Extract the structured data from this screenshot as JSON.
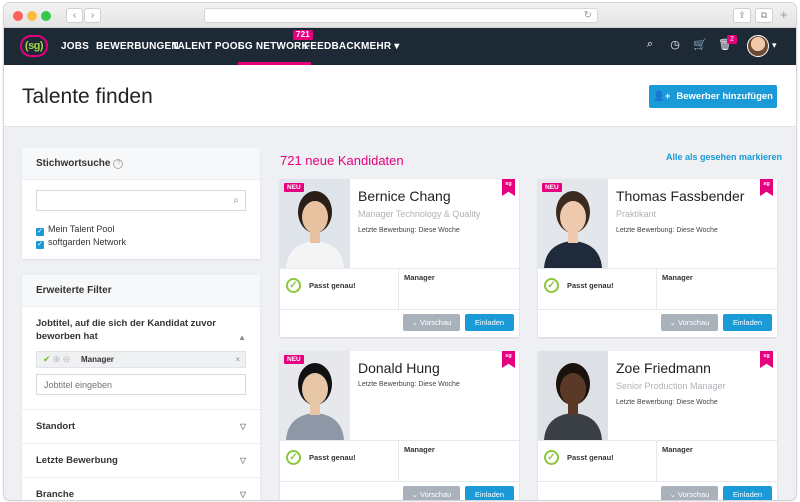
{
  "browser": {
    "back_icon": "‹",
    "forward_icon": "›",
    "reload_icon": "↻",
    "share_icon": "⇪",
    "tabs_icon": "⧉",
    "plus_icon": "+"
  },
  "nav": {
    "logo": "(sg)",
    "items": [
      {
        "label": "JOBS"
      },
      {
        "label": "BEWERBUNGEN"
      },
      {
        "label": "TALENT POOL"
      },
      {
        "label": "SG NETWORK",
        "badge": "721"
      },
      {
        "label": "FEEDBACK"
      },
      {
        "label": "MEHR ▾"
      }
    ],
    "trash_badge": "2",
    "icons": {
      "search": "⌕",
      "clock": "◷",
      "cart": "🛒",
      "trash": "🗑",
      "caret": "▾"
    }
  },
  "page": {
    "title": "Talente finden",
    "add_button": "Bewerber hinzufügen",
    "add_icon": "👤+"
  },
  "sidebar": {
    "keyword_title": "Stichwortsuche",
    "help": "?",
    "search_icon": "⌕",
    "search_value": "",
    "checks": [
      {
        "label": "Mein Talent Pool"
      },
      {
        "label": "softgarden Network"
      }
    ],
    "advanced_title": "Erweiterte Filter",
    "jobtitle_label": "Jobtitel, auf die sich der Kandidat zuvor beworben hat",
    "tag_label": "Manager",
    "tag_remove": "×",
    "job_placeholder": "Jobtitel eingeben",
    "accordions": [
      {
        "label": "Standort"
      },
      {
        "label": "Letzte Bewerbung"
      },
      {
        "label": "Branche"
      }
    ]
  },
  "results": {
    "count_label": "721 neue Kandidaten",
    "mark_all": "Alle als gesehen markieren"
  },
  "card_labels": {
    "neu": "NEU",
    "ribbon": "sg",
    "match": "Passt genau!",
    "preview": "Vorschau",
    "invite": "Einladen",
    "check": "✓"
  },
  "candidates": [
    {
      "name": "Bernice Chang",
      "role": "Manager Technology & Quality",
      "last": "Letzte Bewerbung: Diese Woche",
      "job": "Manager",
      "is_new": true,
      "colors": {
        "bg": "#dfe4ea",
        "skin": "#e8c2a0",
        "hair": "#2b1d17",
        "shirt": "#f4f4f4"
      }
    },
    {
      "name": "Thomas Fassbender",
      "role": "Praktikant",
      "last": "Letzte Bewerbung: Diese Woche",
      "job": "Manager",
      "is_new": true,
      "colors": {
        "bg": "#e3e6ea",
        "skin": "#efc9ad",
        "hair": "#3a2a20",
        "shirt": "#1f2a3a"
      }
    },
    {
      "name": "Donald Hung",
      "role": "",
      "last": "Letzte Bewerbung: Diese Woche",
      "job": "Manager",
      "is_new": true,
      "colors": {
        "bg": "#e6e8ec",
        "skin": "#e7c6a5",
        "hair": "#111111",
        "shirt": "#8d97a6"
      }
    },
    {
      "name": "Zoe Friedmann",
      "role": "Senior Production Manager",
      "last": "Letzte Bewerbung: Diese Woche",
      "job": "Manager",
      "is_new": false,
      "colors": {
        "bg": "#dde1e6",
        "skin": "#5a3a26",
        "hair": "#1a120d",
        "shirt": "#3a3f46"
      }
    }
  ]
}
